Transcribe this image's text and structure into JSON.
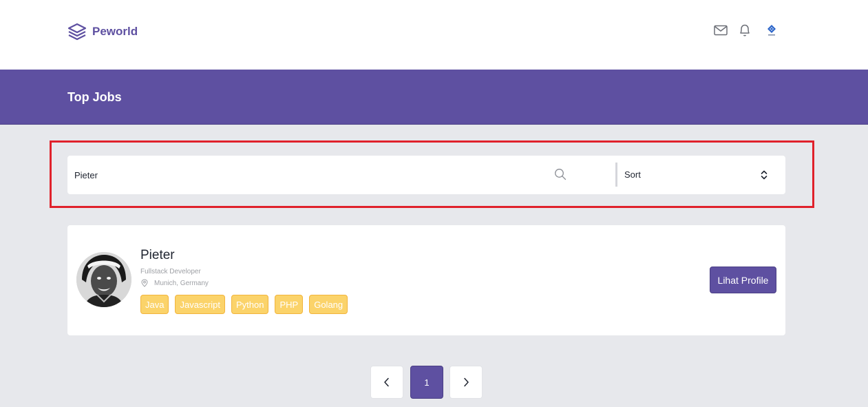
{
  "navbar": {
    "brand": "Peworld",
    "icons": [
      "mail-icon",
      "bell-icon",
      "user-avatar"
    ]
  },
  "banner": {
    "title": "Top Jobs"
  },
  "search": {
    "value": "Pieter",
    "placeholder": "",
    "sort_label": "Sort"
  },
  "result": {
    "name": "Pieter",
    "job": "Fullstack Developer",
    "location": "Munich, Germany",
    "skills": [
      "Java",
      "Javascript",
      "Python",
      "PHP",
      "Golang"
    ],
    "button": "Lihat Profile"
  },
  "pagination": {
    "current": "1"
  },
  "colors": {
    "primary": "#5e50a1",
    "skill_bg": "#fbd36a",
    "skill_border": "#f2b43c",
    "highlight": "#e0212b",
    "page_bg": "#e7e8ec"
  }
}
